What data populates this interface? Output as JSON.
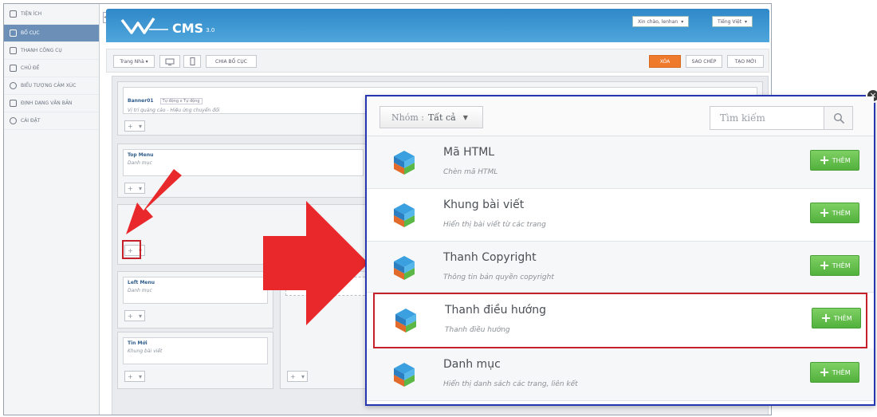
{
  "sidebar": {
    "items": [
      {
        "label": "TIỆN ÍCH",
        "active": false
      },
      {
        "label": "BỐ CỤC",
        "active": true
      },
      {
        "label": "THANH CÔNG CỤ",
        "active": false
      },
      {
        "label": "CHỦ ĐỀ",
        "active": false
      },
      {
        "label": "BIỂU TƯỢNG CẢM XÚC",
        "active": false
      },
      {
        "label": "ĐỊNH DẠNG VĂN BẢN",
        "active": false
      },
      {
        "label": "CÀI ĐẶT",
        "active": false
      }
    ],
    "collapse_label": "<<"
  },
  "header": {
    "logo_text": "CMS",
    "logo_version": "3.0",
    "greeting": "Xin chào, lenhan",
    "language": "Tiếng Việt"
  },
  "toolbar": {
    "page_select": "Trang Nhà",
    "split_layout": "CHIA BỐ CỤC",
    "delete": "XÓA",
    "copy": "SAO CHÉP",
    "create": "TẠO MỚI"
  },
  "layout_blocks": [
    {
      "name": "Banner01",
      "tag": "Tự động x Tự động",
      "desc": "Vị trí quảng cáo - Hiệu ứng chuyển đổi"
    },
    {
      "name": "Top Menu",
      "desc": "Danh mục"
    },
    {
      "name": "Left Menu",
      "desc": "Danh mục"
    },
    {
      "name": "Tin Mới",
      "desc": "Khung bài viết"
    }
  ],
  "dialog": {
    "group_label": "Nhóm :",
    "group_value": "Tất cả",
    "search_placeholder": "Tìm kiếm",
    "modules": [
      {
        "title": "Mã HTML",
        "desc": "Chèn mã HTML",
        "button": "THÊM",
        "highlighted": false
      },
      {
        "title": "Khung bài viết",
        "desc": "Hiển thị bài viết từ các trang",
        "button": "THÊM",
        "highlighted": false
      },
      {
        "title": "Thanh Copyright",
        "desc": "Thông tin bản quyền copyright",
        "button": "THÊM",
        "highlighted": false
      },
      {
        "title": "Thanh điều hướng",
        "desc": "Thanh điều hướng",
        "button": "THÊM",
        "highlighted": true
      },
      {
        "title": "Danh mục",
        "desc": "Hiển thị danh sách các trang, liên kết",
        "button": "THÊM",
        "highlighted": false
      }
    ]
  },
  "colors": {
    "highlight_red": "#c6202a",
    "arrow_red": "#e8282b",
    "dialog_border": "#2636b0",
    "add_green": "#52b13d",
    "header_blue": "#2f88c8",
    "orange": "#f07a2c"
  },
  "icons": [
    "x-icon",
    "search-icon",
    "caret-down-icon",
    "plus-icon",
    "cube-module-icon",
    "desktop-icon",
    "mobile-icon"
  ]
}
